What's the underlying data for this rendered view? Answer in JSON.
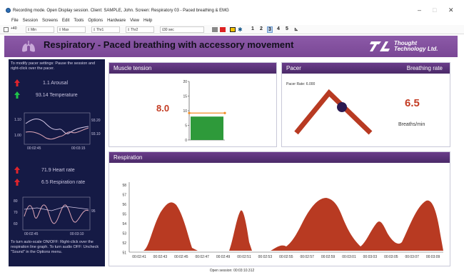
{
  "window": {
    "title": "Recording mode. Open Display session. Client: SAMPLE, John. Screen: Respiratory 03 - Paced breathing & EMG",
    "minimize": "–",
    "maximize": "□",
    "close": "✕"
  },
  "menu": [
    "File",
    "Session",
    "Screens",
    "Edit",
    "Tools",
    "Options",
    "Hardware",
    "View",
    "Help"
  ],
  "toolbar": {
    "mute_label": "+40",
    "min_label": "Min",
    "max_label": "Max",
    "thr1_label": "Thr1",
    "thr2_label": "Thr2",
    "time_label": "30 sec",
    "screens": [
      "1",
      "2",
      "3",
      "4",
      "5"
    ],
    "active_screen": "3"
  },
  "header": {
    "title": "Respiratory - Paced breathing with accessory movement",
    "brand_line1": "Thought",
    "brand_line2": "Technology Ltd."
  },
  "left": {
    "instructions": "To modify pacer settings: Pause the session and right-click over the pacer.",
    "arousal": "1.1  Arousal",
    "temperature": "93.14  Temperature",
    "temp_graph": {
      "y1": "1.10",
      "y2": "1.00",
      "r1": "93.20",
      "r2": "93.10",
      "t1": "00:02:45",
      "t2": "00:03:15"
    },
    "heart_rate": "71.9  Heart rate",
    "resp_rate": "6.5  Respiration rate",
    "hr_graph": {
      "y1": "80",
      "y2": "70",
      "y3": "60",
      "r1": "95",
      "t1": "00:02:45",
      "t2": "00:03:10"
    },
    "footer": "To turn auto-scale ON/OFF: Right-click over the respiration line graph. To turn audio OFF: Uncheck \"Sound\" in the Options menu."
  },
  "muscle": {
    "title": "Muscle tension",
    "value": "8.0",
    "bar_value": 8.0,
    "threshold": 9.2,
    "yticks": [
      "20",
      "15",
      "10",
      "5",
      "0"
    ]
  },
  "pacer": {
    "title": "Pacer",
    "right_title": "Breathing rate",
    "rate_label": "Pacer Rate: 6.000",
    "breathing_value": "6.5",
    "unit": "Breaths/min"
  },
  "respiration": {
    "title": "Respiration",
    "yticks": [
      "58",
      "57",
      "56",
      "55",
      "54",
      "53",
      "52",
      "51"
    ],
    "xticks": [
      "00:02:41",
      "00:02:43",
      "00:02:45",
      "00:02:47",
      "00:02:49",
      "00:02:51",
      "00:02:53",
      "00:02:55",
      "00:02:57",
      "00:02:59",
      "00:03:01",
      "00:03:03",
      "00:03:05",
      "00:03:07",
      "00:03:09"
    ]
  },
  "status": "Open session: 00:03:10.312",
  "colors": {
    "accent": "#7a4795",
    "panel_dark": "#151a45",
    "red": "#c33b22",
    "green": "#2e9a3a"
  }
}
